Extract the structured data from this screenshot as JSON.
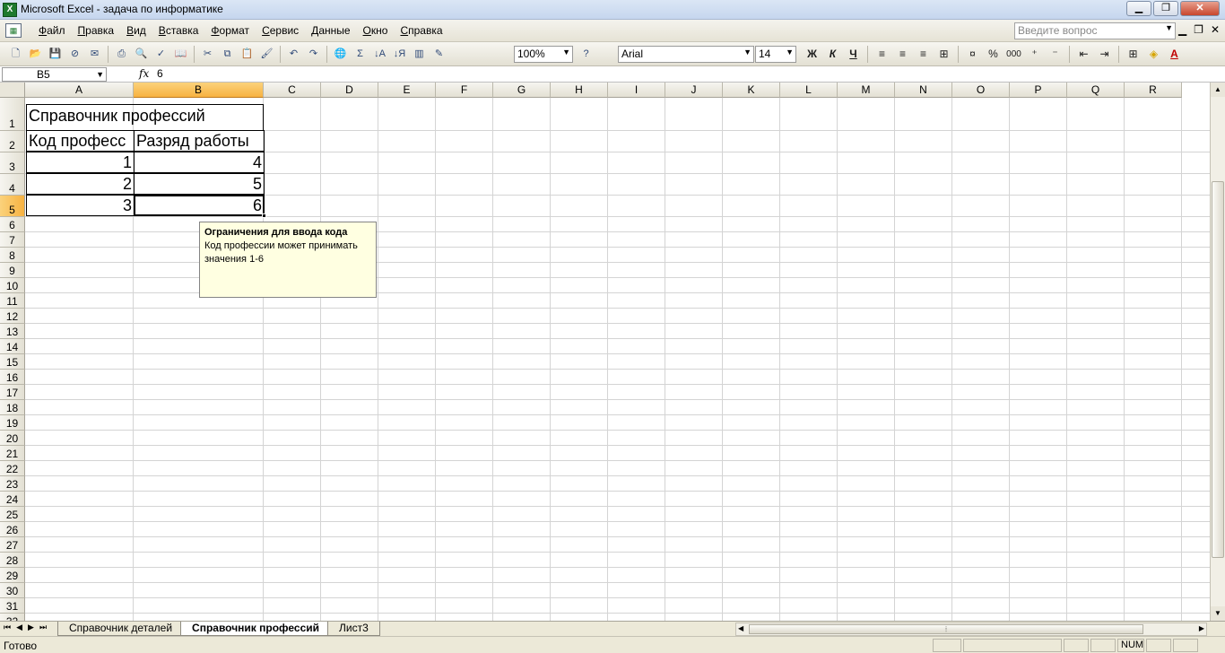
{
  "window": {
    "title": "Microsoft Excel - задача по информатике",
    "app_icon": "excel-icon",
    "controls": [
      "minimize-icon",
      "maximize-icon",
      "close-icon"
    ]
  },
  "menu": {
    "items": [
      "Файл",
      "Правка",
      "Вид",
      "Вставка",
      "Формат",
      "Сервис",
      "Данные",
      "Окно",
      "Справка"
    ],
    "help_placeholder": "Введите вопрос"
  },
  "toolbar": {
    "zoom": "100%",
    "font": "Arial",
    "font_size": "14",
    "bold": "Ж",
    "italic": "К",
    "underline": "Ч",
    "percent": "%",
    "thousands": "000"
  },
  "formula_bar": {
    "cell_ref": "B5",
    "fx_label": "fx",
    "value": "6"
  },
  "grid": {
    "columns": [
      "A",
      "B",
      "C",
      "D",
      "E",
      "F",
      "G",
      "H",
      "I",
      "J",
      "K",
      "L",
      "M",
      "N",
      "O",
      "P",
      "Q",
      "R"
    ],
    "rows": [
      "1",
      "2",
      "3",
      "4",
      "5",
      "6",
      "7",
      "8",
      "9",
      "10",
      "11",
      "12",
      "13",
      "14",
      "15",
      "16",
      "17",
      "18",
      "19",
      "20",
      "21",
      "22",
      "23",
      "24",
      "25",
      "26",
      "27",
      "28",
      "29",
      "30",
      "31",
      "32"
    ],
    "selected_column": "B",
    "selected_row": "5",
    "cells": {
      "A1": "Справочник профессий",
      "A2": "Код професс",
      "B2": "Разряд работы",
      "A3": "1",
      "B3": "4",
      "A4": "2",
      "B4": "5",
      "A5": "3",
      "B5": "6"
    }
  },
  "validation_tooltip": {
    "title": "Ограничения для ввода кода",
    "message": "Код профессии может принимать значения 1-6"
  },
  "sheets": {
    "tabs": [
      "Справочник деталей",
      "Справочник профессий",
      "Лист3"
    ],
    "active": "Справочник профессий"
  },
  "status": {
    "text": "Готово",
    "num_lock": "NUM"
  }
}
